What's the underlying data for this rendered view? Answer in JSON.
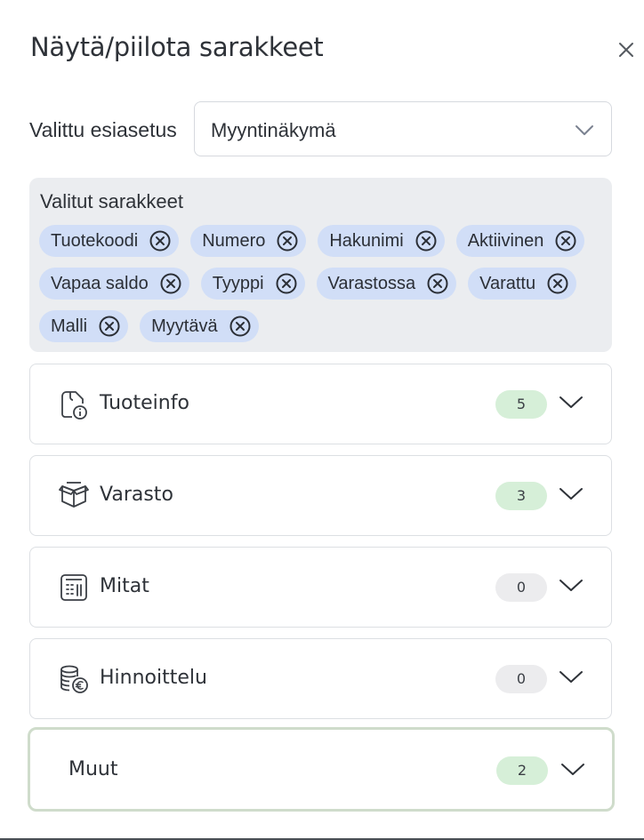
{
  "dialog": {
    "title": "Näytä/piilota sarakkeet",
    "close_icon": "close-icon"
  },
  "preset": {
    "label": "Valittu esiasetus",
    "value": "Myyntinäkymä"
  },
  "selected_columns": {
    "title": "Valitut sarakkeet",
    "chips": [
      "Tuotekoodi",
      "Numero",
      "Hakunimi",
      "Aktiivinen",
      "Vapaa saldo",
      "Tyyppi",
      "Varastossa",
      "Varattu",
      "Malli",
      "Myytävä"
    ]
  },
  "groups": [
    {
      "label": "Tuoteinfo",
      "count": "5",
      "icon": "product-info-icon",
      "badge": "green"
    },
    {
      "label": "Varasto",
      "count": "3",
      "icon": "boxes-icon",
      "badge": "green"
    },
    {
      "label": "Mitat",
      "count": "0",
      "icon": "calculator-icon",
      "badge": "gray"
    },
    {
      "label": "Hinnoittelu",
      "count": "0",
      "icon": "coins-euro-icon",
      "badge": "gray"
    },
    {
      "label": "Muut",
      "count": "2",
      "icon": "",
      "badge": "green"
    }
  ],
  "colors": {
    "chip_bg": "#d1def7",
    "selected_box_bg": "#ebedf0",
    "badge_green": "#d6efd8",
    "badge_gray": "#ececee",
    "active_border": "#cfdccb"
  }
}
